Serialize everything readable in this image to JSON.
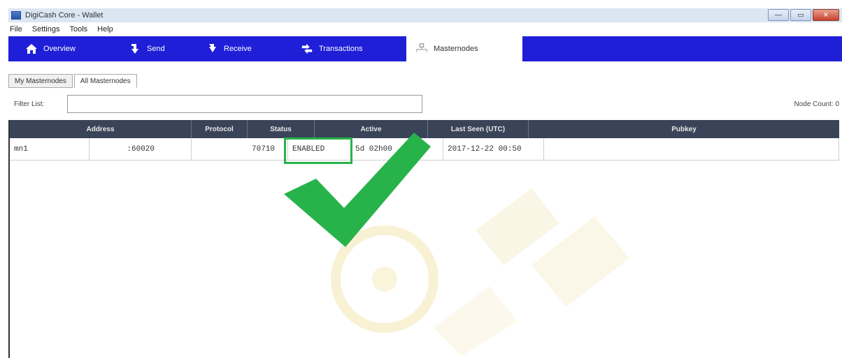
{
  "window": {
    "title": "DigiCash Core - Wallet",
    "min_glyph": "—",
    "max_glyph": "▭",
    "close_glyph": "✕"
  },
  "menu": [
    "File",
    "Settings",
    "Tools",
    "Help"
  ],
  "toolbar": {
    "tabs": [
      {
        "label": "Overview",
        "icon": "home-icon"
      },
      {
        "label": "Send",
        "icon": "send-icon"
      },
      {
        "label": "Receive",
        "icon": "receive-icon"
      },
      {
        "label": "Transactions",
        "icon": "transactions-icon"
      },
      {
        "label": "Masternodes",
        "icon": "network-icon",
        "active": true
      }
    ]
  },
  "subtabs": [
    "My Masternodes",
    "All Masternodes"
  ],
  "filter": {
    "label": "Filter List:",
    "value": "",
    "node_count_label": "Node Count:",
    "node_count": "0"
  },
  "table": {
    "headers": [
      "Address",
      "Protocol",
      "Status",
      "Active",
      "Last Seen (UTC)",
      "Pubkey"
    ],
    "rows": [
      {
        "alias": "mn1",
        "address": ":60020",
        "protocol": "70710",
        "status": "ENABLED",
        "active": "5d 02h00",
        "last_seen": "2017-12-22 00:50",
        "pubkey": ""
      }
    ]
  },
  "colors": {
    "accent": "#1f1fd8",
    "header": "#3a4458",
    "highlight": "#27b34a",
    "watermark": "#e8c640"
  }
}
